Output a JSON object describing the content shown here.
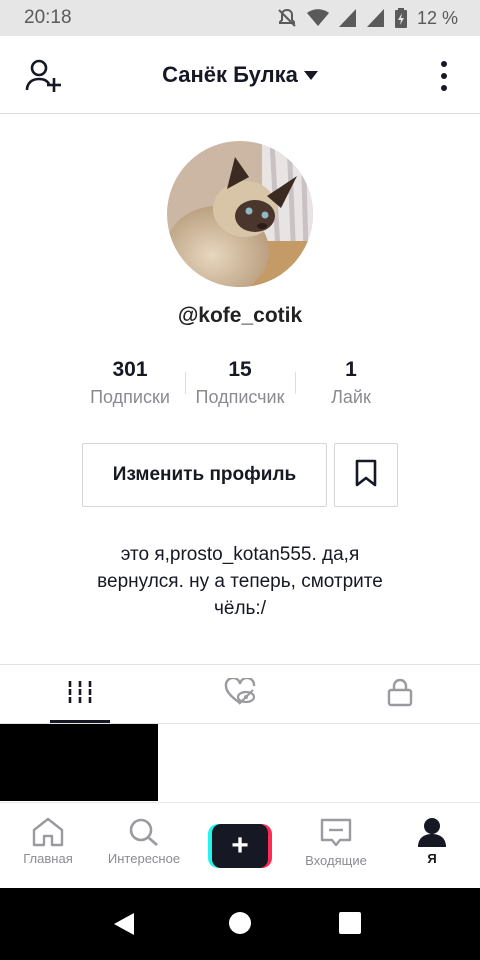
{
  "status_bar": {
    "time": "20:18",
    "battery": "12 %",
    "icons": [
      "muted-bell-icon",
      "wifi-icon",
      "signal-icon",
      "signal-icon",
      "battery-icon"
    ]
  },
  "header": {
    "title": "Санёк Булка",
    "icons": [
      "add-user-icon",
      "dropdown-caret-icon",
      "more-vertical-icon"
    ]
  },
  "profile": {
    "handle": "@kofe_cotik",
    "stats": [
      {
        "value": "301",
        "label": "Подписки"
      },
      {
        "value": "15",
        "label": "Подписчик"
      },
      {
        "value": "1",
        "label": "Лайк"
      }
    ],
    "edit_label": "Изменить профиль",
    "bio_line1": "это я,prosto_kotan555. да,я",
    "bio_line2": "вернулся. ну а теперь, смотрите",
    "bio_line3": "чёль:/"
  },
  "tabs": {
    "icons": [
      "videos-grid-icon",
      "liked-hidden-icon",
      "lock-icon"
    ],
    "active": 0
  },
  "bottom_nav": {
    "items": [
      {
        "label": "Главная",
        "icon": "home-icon"
      },
      {
        "label": "Интересное",
        "icon": "search-icon"
      },
      {
        "label": "",
        "icon": "create-plus-icon"
      },
      {
        "label": "Входящие",
        "icon": "inbox-icon"
      },
      {
        "label": "Я",
        "icon": "profile-icon"
      }
    ],
    "active": 4
  },
  "colors": {
    "text": "#161823",
    "secondary": "#8a8b91",
    "accent_cyan": "#25f4ee",
    "accent_red": "#fe2c55"
  }
}
